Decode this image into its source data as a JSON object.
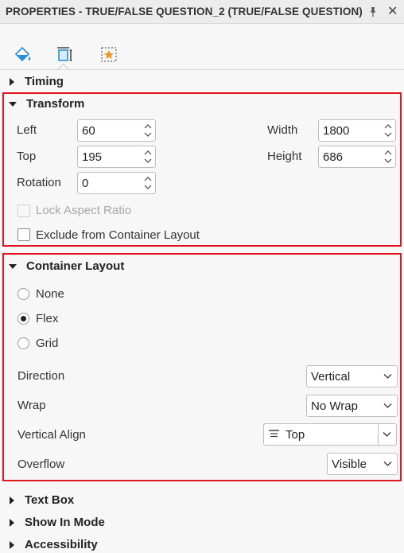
{
  "panel": {
    "title": "PROPERTIES - TRUE/FALSE QUESTION_2 (TRUE/FALSE QUESTION)",
    "pin_icon": "pin-icon",
    "close_icon": "close-icon",
    "close_glyph": "✕"
  },
  "tabs": [
    {
      "icon": "paint-bucket-icon",
      "active": false
    },
    {
      "icon": "transform-icon",
      "active": true
    },
    {
      "icon": "star-frame-icon",
      "active": false
    }
  ],
  "sections": {
    "timing": {
      "label": "Timing",
      "expanded": false
    },
    "transform": {
      "label": "Transform",
      "expanded": true,
      "left_label": "Left",
      "left_value": "60",
      "top_label": "Top",
      "top_value": "195",
      "rotation_label": "Rotation",
      "rotation_value": "0",
      "width_label": "Width",
      "width_value": "1800",
      "height_label": "Height",
      "height_value": "686",
      "lock_aspect_label": "Lock Aspect Ratio",
      "exclude_label": "Exclude from Container Layout"
    },
    "container_layout": {
      "label": "Container Layout",
      "expanded": true,
      "radio_none": "None",
      "radio_flex": "Flex",
      "radio_grid": "Grid",
      "selected": "Flex",
      "direction_label": "Direction",
      "direction_value": "Vertical",
      "wrap_label": "Wrap",
      "wrap_value": "No Wrap",
      "valign_label": "Vertical Align",
      "valign_value": "Top",
      "overflow_label": "Overflow",
      "overflow_value": "Visible"
    },
    "text_box": {
      "label": "Text Box",
      "expanded": false
    },
    "show_in_mode": {
      "label": "Show In Mode",
      "expanded": false
    },
    "accessibility": {
      "label": "Accessibility",
      "expanded": false
    }
  },
  "colors": {
    "highlight_border": "#e0161e",
    "icon_blue": "#2b8fd6",
    "icon_orange": "#e8962a"
  }
}
